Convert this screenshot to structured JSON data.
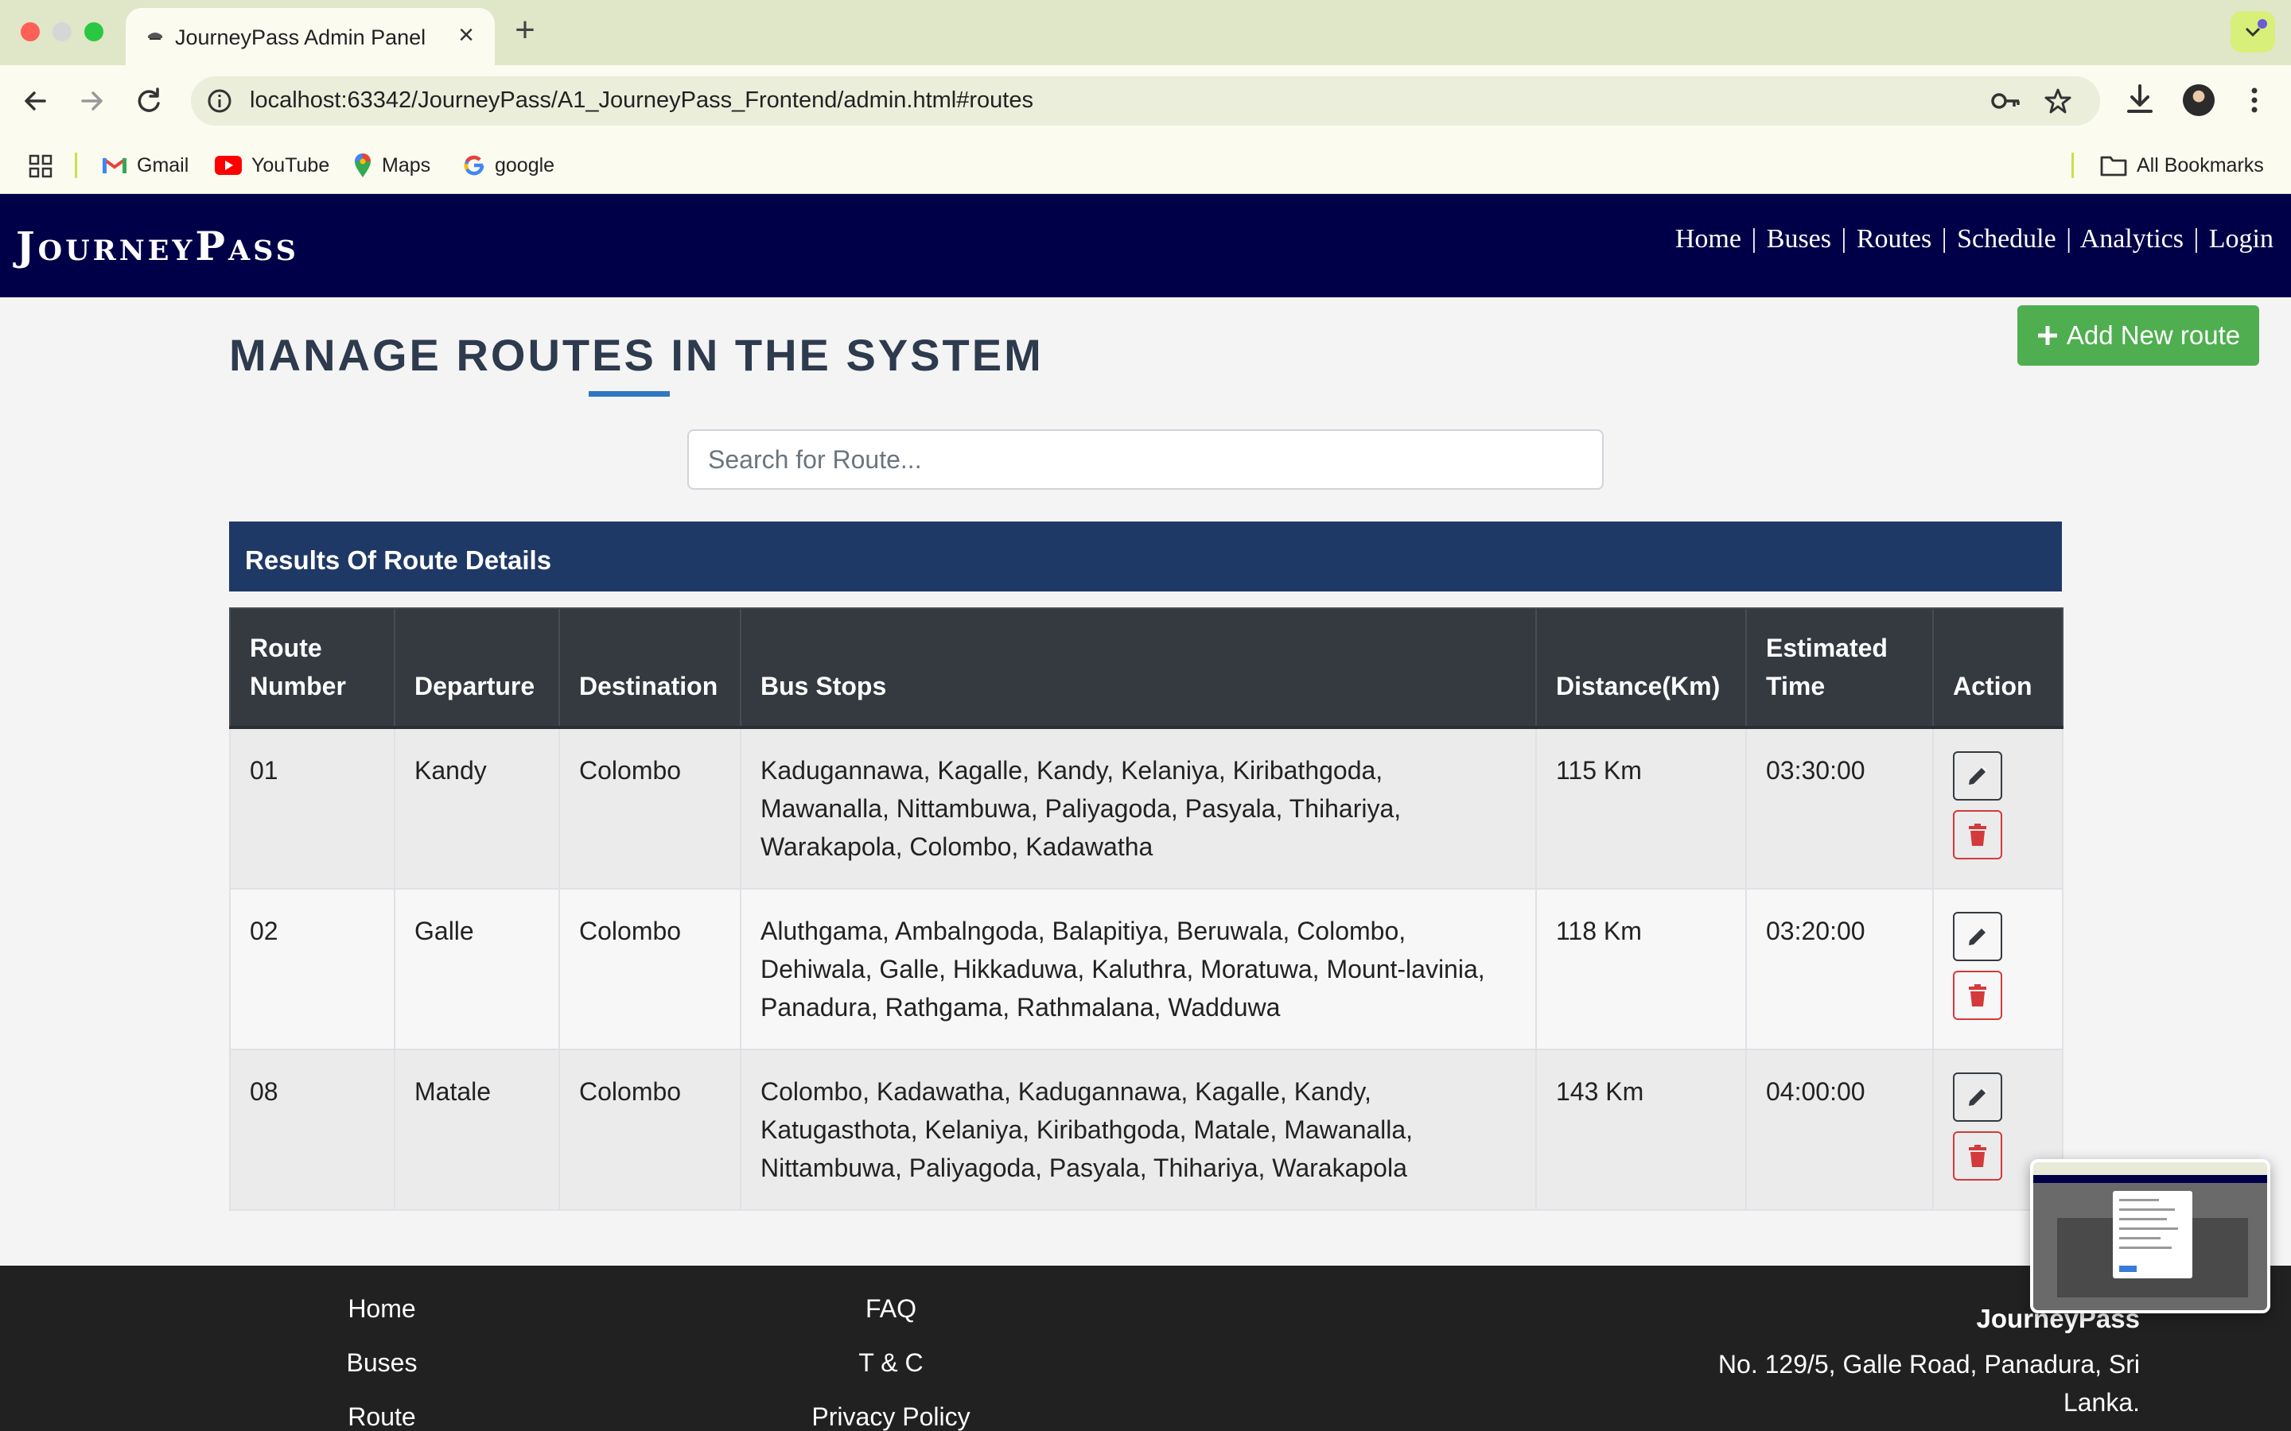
{
  "browser": {
    "tab_title": "JourneyPass Admin Panel",
    "tab_close": "×",
    "new_tab": "+",
    "url": "localhost:63342/JourneyPass/A1_JourneyPass_Frontend/admin.html#routes",
    "bookmarks": [
      "Gmail",
      "YouTube",
      "Maps",
      "google"
    ],
    "all_bookmarks": "All Bookmarks"
  },
  "navbar": {
    "brand": "JourneyPass",
    "links": [
      "Home",
      "Buses",
      "Routes",
      "Schedule",
      "Analytics",
      "Login"
    ],
    "separator": "|"
  },
  "main": {
    "title": "MANAGE ROUTES IN THE SYSTEM",
    "add_button": "Add New route",
    "search_placeholder": "Search for Route...",
    "results_header": "Results Of Route Details"
  },
  "table": {
    "headers": [
      "Route Number",
      "Departure",
      "Destination",
      "Bus Stops",
      "Distance(Km)",
      "Estimated Time",
      "Action"
    ],
    "rows": [
      {
        "route_number": "01",
        "departure": "Kandy",
        "destination": "Colombo",
        "bus_stops": "Kadugannawa, Kagalle, Kandy, Kelaniya, Kiribathgoda, Mawanalla, Nittambuwa, Paliyagoda, Pasyala, Thihariya, Warakapola, Colombo, Kadawatha",
        "distance": "115 Km",
        "time": "03:30:00"
      },
      {
        "route_number": "02",
        "departure": "Galle",
        "destination": "Colombo",
        "bus_stops": "Aluthgama, Ambalngoda, Balapitiya, Beruwala, Colombo, Dehiwala, Galle, Hikkaduwa, Kaluthra, Moratuwa, Mount-lavinia, Panadura, Rathgama, Rathmalana, Wadduwa",
        "distance": "118 Km",
        "time": "03:20:00"
      },
      {
        "route_number": "08",
        "departure": "Matale",
        "destination": "Colombo",
        "bus_stops": "Colombo, Kadawatha, Kadugannawa, Kagalle, Kandy, Katugasthota, Kelaniya, Kiribathgoda, Matale, Mawanalla, Nittambuwa, Paliyagoda, Pasyala, Thihariya, Warakapola",
        "distance": "143 Km",
        "time": "04:00:00"
      }
    ]
  },
  "footer": {
    "col1": [
      "Home",
      "Buses",
      "Route"
    ],
    "col2": [
      "FAQ",
      "T & C",
      "Privacy Policy"
    ],
    "company": "JourneyPass",
    "address": "No. 129/5, Galle Road, Panadura, Sri Lanka."
  },
  "colors": {
    "navbar_bg": "#000048",
    "results_header_bg": "#1f3966",
    "table_header_bg": "#343a40",
    "add_button_bg": "#4fae4f",
    "delete_red": "#d33a3a",
    "title_underline": "#2f77c3",
    "footer_bg": "#212121"
  },
  "icons": {
    "tab_favicon": "bus-favicon",
    "add_button_icon": "plus-icon",
    "edit": "pencil-icon",
    "delete": "trash-icon"
  }
}
